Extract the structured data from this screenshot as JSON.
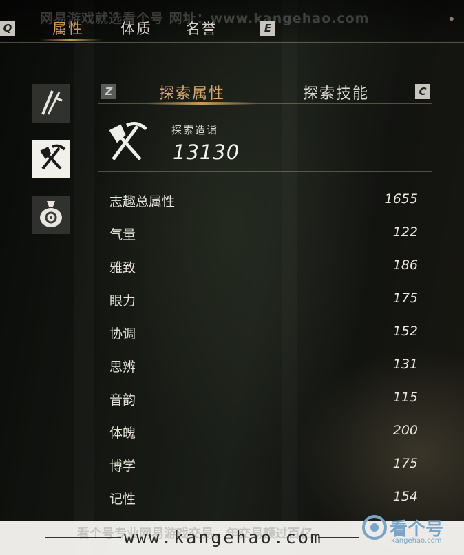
{
  "watermark": {
    "top": "网易游戏就选看个号  网址：www.kangehao.com",
    "bottom": "看个号专业网易游戏交易，年交易额过百亿",
    "bottom_url": "www.kangehao.com",
    "logo_text": "看个号",
    "logo_sub": "kangehao.com"
  },
  "top_tabs": {
    "key_left": "Q",
    "key_right": "E",
    "tabs": [
      {
        "label": "属性",
        "active": true
      },
      {
        "label": "体质",
        "active": false
      },
      {
        "label": "名誉",
        "active": false
      }
    ]
  },
  "side_icons": [
    {
      "icon": "weapons-icon",
      "selected": false
    },
    {
      "icon": "shovel-pickaxe-icon",
      "selected": true
    },
    {
      "icon": "money-bag-icon",
      "selected": false
    }
  ],
  "sub_tabs": {
    "key_left": "Z",
    "key_right": "C",
    "tabs": [
      {
        "label": "探索属性",
        "active": true
      },
      {
        "label": "探索技能",
        "active": false
      }
    ]
  },
  "summary": {
    "label": "探索造诣",
    "value": "13130"
  },
  "attributes": [
    {
      "label": "志趣总属性",
      "value": "1655"
    },
    {
      "label": "气量",
      "value": "122"
    },
    {
      "label": "雅致",
      "value": "186"
    },
    {
      "label": "眼力",
      "value": "175"
    },
    {
      "label": "协调",
      "value": "152"
    },
    {
      "label": "思辨",
      "value": "131"
    },
    {
      "label": "音韵",
      "value": "115"
    },
    {
      "label": "体魄",
      "value": "200"
    },
    {
      "label": "博学",
      "value": "175"
    },
    {
      "label": "记性",
      "value": "154"
    }
  ],
  "colors": {
    "accent": "#cf9a55",
    "text": "#e8e4da"
  }
}
